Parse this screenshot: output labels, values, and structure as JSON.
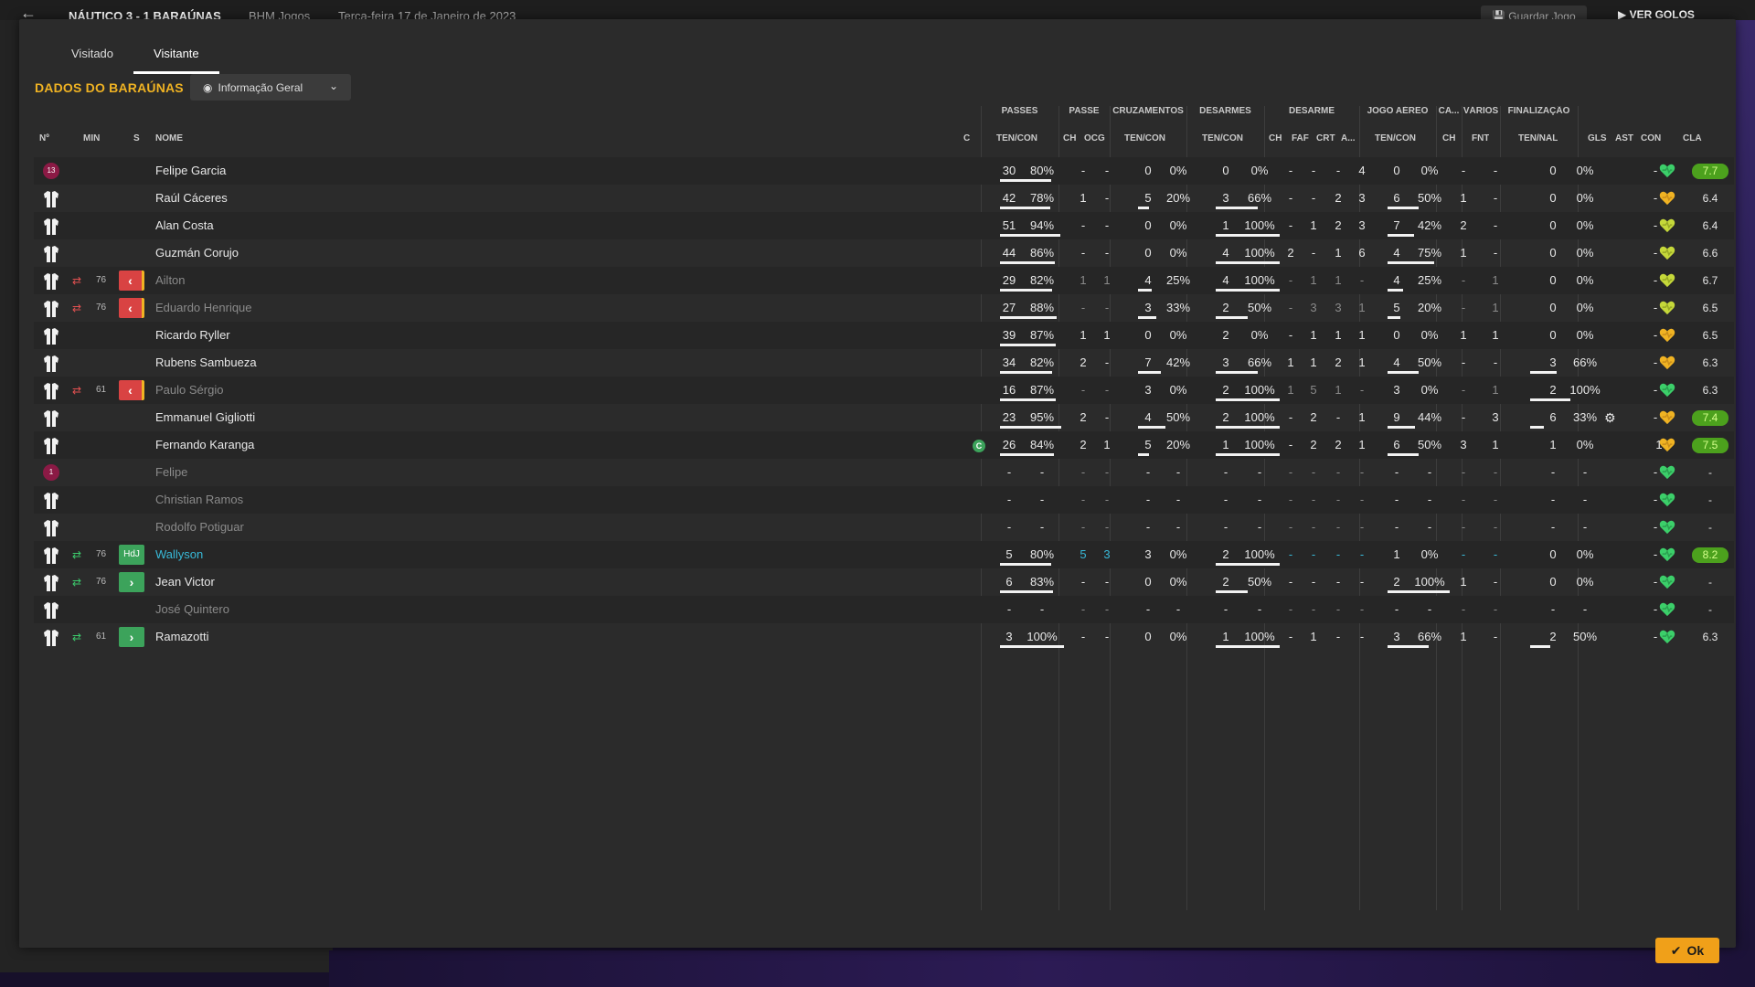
{
  "topbar": {
    "match": "NÁUTICO  3 - 1  BARAÚNAS",
    "competition": "BHM Jogos",
    "date": "Terça-feira 17 de Janeiro de 2023",
    "save_label": "Guardar Jogo",
    "goals_label": "VER GOLOS"
  },
  "tabs": [
    "Visitado",
    "Visitante"
  ],
  "active_tab": "Visitante",
  "section_title": "DADOS DO BARAÚNAS",
  "view_dropdown": "Informação Geral",
  "ok_label": "Ok",
  "group_headers": {
    "passes": "PASSES",
    "passe": "PASSE",
    "cruzamentos": "CRUZAMENTOS",
    "desarmes": "DESARMES",
    "desarme": "DESARME",
    "jogo_aereo": "JOGO AÉREO",
    "ca": "CA...",
    "varios": "VÁRIOS",
    "finalizacao": "FINALIZAÇÃO"
  },
  "col_headers": {
    "no": "Nº",
    "min": "MIN",
    "s": "S",
    "nome": "NOME",
    "c": "C",
    "pass_tc": "TEN/CON",
    "pass_ch": "CH",
    "pass_ocg": "OCG",
    "cruz_tc": "TEN/CON",
    "des_tc": "TEN/CON",
    "d_ch": "CH",
    "d_faf": "FAF",
    "d_crt": "CRT",
    "d_a": "A...",
    "ja_tc": "TEN/CON",
    "ca_ch": "CH",
    "v_fnt": "FNT",
    "fin_tn": "TEN/NAL",
    "gls": "GLS",
    "ast": "AST",
    "con": "CON",
    "cla": "CLA"
  },
  "players": [
    {
      "gk": "13",
      "min": "",
      "sub": "",
      "tag": "",
      "name": "Felipe Garcia",
      "dim": false,
      "cap": false,
      "p": [
        "30",
        "80%"
      ],
      "pch": "-",
      "pocg": "-",
      "cz": [
        "0",
        "0%"
      ],
      "ds": [
        "0",
        "0%"
      ],
      "d": [
        "-",
        "-",
        "-",
        "4"
      ],
      "ja": [
        "0",
        "0%"
      ],
      "cach": "-",
      "fnt": "-",
      "fin": [
        "0",
        "0%"
      ],
      "gear": false,
      "gls": "-",
      "ast": "",
      "con": "green",
      "cla": "7.7",
      "good": true,
      "pf": 0.8,
      "czf": 0,
      "dsf": 0,
      "jaf": 0,
      "finf": 0
    },
    {
      "gk": "",
      "min": "",
      "sub": "",
      "tag": "",
      "name": "Raúl Cáceres",
      "dim": false,
      "cap": false,
      "p": [
        "42",
        "78%"
      ],
      "pch": "1",
      "pocg": "-",
      "cz": [
        "5",
        "20%"
      ],
      "ds": [
        "3",
        "66%"
      ],
      "d": [
        "-",
        "-",
        "2",
        "3"
      ],
      "ja": [
        "6",
        "50%"
      ],
      "cach": "1",
      "fnt": "-",
      "fin": [
        "0",
        "0%"
      ],
      "gear": false,
      "gls": "-",
      "ast": "",
      "con": "amber",
      "cla": "6.4",
      "good": false,
      "pf": 0.78,
      "czf": 0.2,
      "dsf": 0.66,
      "jaf": 0.5,
      "finf": 0
    },
    {
      "gk": "",
      "min": "",
      "sub": "",
      "tag": "",
      "name": "Alan Costa",
      "dim": false,
      "cap": false,
      "p": [
        "51",
        "94%"
      ],
      "pch": "-",
      "pocg": "-",
      "cz": [
        "0",
        "0%"
      ],
      "ds": [
        "1",
        "100%"
      ],
      "d": [
        "-",
        "1",
        "2",
        "3"
      ],
      "ja": [
        "7",
        "42%"
      ],
      "cach": "2",
      "fnt": "-",
      "fin": [
        "0",
        "0%"
      ],
      "gear": false,
      "gls": "-",
      "ast": "",
      "con": "yellow",
      "cla": "6.4",
      "good": false,
      "pf": 0.94,
      "czf": 0,
      "dsf": 1,
      "jaf": 0.42,
      "finf": 0
    },
    {
      "gk": "",
      "min": "",
      "sub": "",
      "tag": "",
      "name": "Guzmán Corujo",
      "dim": false,
      "cap": false,
      "p": [
        "44",
        "86%"
      ],
      "pch": "-",
      "pocg": "-",
      "cz": [
        "0",
        "0%"
      ],
      "ds": [
        "4",
        "100%"
      ],
      "d": [
        "2",
        "-",
        "1",
        "6"
      ],
      "ja": [
        "4",
        "75%"
      ],
      "cach": "1",
      "fnt": "-",
      "fin": [
        "0",
        "0%"
      ],
      "gear": false,
      "gls": "-",
      "ast": "",
      "con": "yellow",
      "cla": "6.6",
      "good": false,
      "pf": 0.86,
      "czf": 0,
      "dsf": 1,
      "jaf": 0.75,
      "finf": 0
    },
    {
      "gk": "",
      "min": "76",
      "sub": "out",
      "tag": "out",
      "name": "Ailton",
      "dim": true,
      "cap": false,
      "p": [
        "29",
        "82%"
      ],
      "pch": "1",
      "pocg": "1",
      "cz": [
        "4",
        "25%"
      ],
      "ds": [
        "4",
        "100%"
      ],
      "d": [
        "-",
        "1",
        "1",
        "-"
      ],
      "ja": [
        "4",
        "25%"
      ],
      "cach": "-",
      "fnt": "1",
      "fin": [
        "0",
        "0%"
      ],
      "gear": false,
      "gls": "-",
      "ast": "",
      "con": "yellow",
      "cla": "6.7",
      "good": false,
      "pf": 0.82,
      "czf": 0.25,
      "dsf": 1,
      "jaf": 0.25,
      "finf": 0
    },
    {
      "gk": "",
      "min": "76",
      "sub": "out",
      "tag": "out",
      "name": "Eduardo Henrique",
      "dim": true,
      "cap": false,
      "p": [
        "27",
        "88%"
      ],
      "pch": "-",
      "pocg": "-",
      "cz": [
        "3",
        "33%"
      ],
      "ds": [
        "2",
        "50%"
      ],
      "d": [
        "-",
        "3",
        "3",
        "1"
      ],
      "ja": [
        "5",
        "20%"
      ],
      "cach": "-",
      "fnt": "1",
      "fin": [
        "0",
        "0%"
      ],
      "gear": false,
      "gls": "-",
      "ast": "",
      "con": "yellow",
      "cla": "6.5",
      "good": false,
      "pf": 0.88,
      "czf": 0.33,
      "dsf": 0.5,
      "jaf": 0.2,
      "finf": 0
    },
    {
      "gk": "",
      "min": "",
      "sub": "",
      "tag": "",
      "name": "Ricardo Ryller",
      "dim": false,
      "cap": false,
      "p": [
        "39",
        "87%"
      ],
      "pch": "1",
      "pocg": "1",
      "cz": [
        "0",
        "0%"
      ],
      "ds": [
        "2",
        "0%"
      ],
      "d": [
        "-",
        "1",
        "1",
        "1"
      ],
      "ja": [
        "0",
        "0%"
      ],
      "cach": "1",
      "fnt": "1",
      "fin": [
        "0",
        "0%"
      ],
      "gear": false,
      "gls": "-",
      "ast": "",
      "con": "amber",
      "cla": "6.5",
      "good": false,
      "pf": 0.87,
      "czf": 0,
      "dsf": 0,
      "jaf": 0,
      "finf": 0
    },
    {
      "gk": "",
      "min": "",
      "sub": "",
      "tag": "",
      "name": "Rubens Sambueza",
      "dim": false,
      "cap": false,
      "p": [
        "34",
        "82%"
      ],
      "pch": "2",
      "pocg": "-",
      "cz": [
        "7",
        "42%"
      ],
      "ds": [
        "3",
        "66%"
      ],
      "d": [
        "1",
        "1",
        "2",
        "1"
      ],
      "ja": [
        "4",
        "50%"
      ],
      "cach": "-",
      "fnt": "-",
      "fin": [
        "3",
        "66%"
      ],
      "gear": false,
      "gls": "-",
      "ast": "",
      "con": "amber",
      "cla": "6.3",
      "good": false,
      "pf": 0.82,
      "czf": 0.42,
      "dsf": 0.66,
      "jaf": 0.5,
      "finf": 0.66
    },
    {
      "gk": "",
      "min": "61",
      "sub": "out",
      "tag": "out",
      "name": "Paulo Sérgio",
      "dim": true,
      "cap": false,
      "p": [
        "16",
        "87%"
      ],
      "pch": "-",
      "pocg": "-",
      "cz": [
        "3",
        "0%"
      ],
      "ds": [
        "2",
        "100%"
      ],
      "d": [
        "1",
        "5",
        "1",
        "-"
      ],
      "ja": [
        "3",
        "0%"
      ],
      "cach": "-",
      "fnt": "1",
      "fin": [
        "2",
        "100%"
      ],
      "gear": false,
      "gls": "-",
      "ast": "",
      "con": "green",
      "cla": "6.3",
      "good": false,
      "pf": 0.87,
      "czf": 0,
      "dsf": 1,
      "jaf": 0,
      "finf": 1
    },
    {
      "gk": "",
      "min": "",
      "sub": "",
      "tag": "",
      "name": "Emmanuel Gigliotti",
      "dim": false,
      "cap": false,
      "p": [
        "23",
        "95%"
      ],
      "pch": "2",
      "pocg": "-",
      "cz": [
        "4",
        "50%"
      ],
      "ds": [
        "2",
        "100%"
      ],
      "d": [
        "-",
        "2",
        "-",
        "1"
      ],
      "ja": [
        "9",
        "44%"
      ],
      "cach": "-",
      "fnt": "3",
      "fin": [
        "6",
        "33%"
      ],
      "gear": true,
      "gls": "-",
      "ast": "",
      "con": "amber",
      "cla": "7.4",
      "good": true,
      "pf": 0.95,
      "czf": 0.5,
      "dsf": 1,
      "jaf": 0.44,
      "finf": 0.33
    },
    {
      "gk": "",
      "min": "",
      "sub": "",
      "tag": "",
      "name": "Fernando Karanga",
      "dim": false,
      "cap": true,
      "p": [
        "26",
        "84%"
      ],
      "pch": "2",
      "pocg": "1",
      "cz": [
        "5",
        "20%"
      ],
      "ds": [
        "1",
        "100%"
      ],
      "d": [
        "-",
        "2",
        "2",
        "1"
      ],
      "ja": [
        "6",
        "50%"
      ],
      "cach": "3",
      "fnt": "1",
      "fin": [
        "1",
        "0%"
      ],
      "gear": false,
      "gls": "",
      "ast": "1",
      "con": "amber",
      "cla": "7.5",
      "good": true,
      "pf": 0.84,
      "czf": 0.2,
      "dsf": 1,
      "jaf": 0.5,
      "finf": 0
    },
    {
      "gk": "1",
      "min": "",
      "sub": "",
      "tag": "",
      "name": "Felipe",
      "dim": true,
      "cap": false,
      "p": [
        "-",
        "-"
      ],
      "pch": "-",
      "pocg": "-",
      "cz": [
        "-",
        "-"
      ],
      "ds": [
        "-",
        "-"
      ],
      "d": [
        "-",
        "-",
        "-",
        "-"
      ],
      "ja": [
        "-",
        "-"
      ],
      "cach": "-",
      "fnt": "-",
      "fin": [
        "-",
        "-"
      ],
      "gear": false,
      "gls": "-",
      "ast": "",
      "con": "green",
      "cla": "-",
      "good": false,
      "pf": 0,
      "czf": 0,
      "dsf": 0,
      "jaf": 0,
      "finf": 0
    },
    {
      "gk": "",
      "min": "",
      "sub": "",
      "tag": "",
      "name": "Christian Ramos",
      "dim": true,
      "cap": false,
      "p": [
        "-",
        "-"
      ],
      "pch": "-",
      "pocg": "-",
      "cz": [
        "-",
        "-"
      ],
      "ds": [
        "-",
        "-"
      ],
      "d": [
        "-",
        "-",
        "-",
        "-"
      ],
      "ja": [
        "-",
        "-"
      ],
      "cach": "-",
      "fnt": "-",
      "fin": [
        "-",
        "-"
      ],
      "gear": false,
      "gls": "-",
      "ast": "",
      "con": "green",
      "cla": "-",
      "good": false,
      "pf": 0,
      "czf": 0,
      "dsf": 0,
      "jaf": 0,
      "finf": 0
    },
    {
      "gk": "",
      "min": "",
      "sub": "",
      "tag": "",
      "name": "Rodolfo Potiguar",
      "dim": true,
      "cap": false,
      "p": [
        "-",
        "-"
      ],
      "pch": "-",
      "pocg": "-",
      "cz": [
        "-",
        "-"
      ],
      "ds": [
        "-",
        "-"
      ],
      "d": [
        "-",
        "-",
        "-",
        "-"
      ],
      "ja": [
        "-",
        "-"
      ],
      "cach": "-",
      "fnt": "-",
      "fin": [
        "-",
        "-"
      ],
      "gear": false,
      "gls": "-",
      "ast": "",
      "con": "green",
      "cla": "-",
      "good": false,
      "pf": 0,
      "czf": 0,
      "dsf": 0,
      "jaf": 0,
      "finf": 0
    },
    {
      "gk": "",
      "min": "76",
      "sub": "in",
      "tag": "hdj",
      "name": "Wallyson",
      "dim": false,
      "hl": true,
      "cap": false,
      "p": [
        "5",
        "80%"
      ],
      "pch": "5",
      "pocg": "3",
      "cz": [
        "3",
        "0%"
      ],
      "ds": [
        "2",
        "100%"
      ],
      "d": [
        "-",
        "-",
        "-",
        "-"
      ],
      "ja": [
        "1",
        "0%"
      ],
      "cach": "-",
      "fnt": "-",
      "fin": [
        "0",
        "0%"
      ],
      "gear": false,
      "gls": "-",
      "ast": "",
      "con": "green",
      "cla": "8.2",
      "good": true,
      "pf": 0.8,
      "czf": 0,
      "dsf": 1,
      "jaf": 0,
      "finf": 0
    },
    {
      "gk": "",
      "min": "76",
      "sub": "in",
      "tag": "in",
      "name": "Jean Victor",
      "dim": false,
      "cap": false,
      "p": [
        "6",
        "83%"
      ],
      "pch": "-",
      "pocg": "-",
      "cz": [
        "0",
        "0%"
      ],
      "ds": [
        "2",
        "50%"
      ],
      "d": [
        "-",
        "-",
        "-",
        "-"
      ],
      "ja": [
        "2",
        "100%"
      ],
      "cach": "1",
      "fnt": "-",
      "fin": [
        "0",
        "0%"
      ],
      "gear": false,
      "gls": "-",
      "ast": "",
      "con": "green",
      "cla": "-",
      "good": false,
      "pf": 0.83,
      "czf": 0,
      "dsf": 0.5,
      "jaf": 1,
      "finf": 0
    },
    {
      "gk": "",
      "min": "",
      "sub": "",
      "tag": "",
      "name": "José Quintero",
      "dim": true,
      "cap": false,
      "p": [
        "-",
        "-"
      ],
      "pch": "-",
      "pocg": "-",
      "cz": [
        "-",
        "-"
      ],
      "ds": [
        "-",
        "-"
      ],
      "d": [
        "-",
        "-",
        "-",
        "-"
      ],
      "ja": [
        "-",
        "-"
      ],
      "cach": "-",
      "fnt": "-",
      "fin": [
        "-",
        "-"
      ],
      "gear": false,
      "gls": "-",
      "ast": "",
      "con": "green",
      "cla": "-",
      "good": false,
      "pf": 0,
      "czf": 0,
      "dsf": 0,
      "jaf": 0,
      "finf": 0
    },
    {
      "gk": "",
      "min": "61",
      "sub": "in",
      "tag": "in",
      "name": "Ramazotti",
      "dim": false,
      "cap": false,
      "p": [
        "3",
        "100%"
      ],
      "pch": "-",
      "pocg": "-",
      "cz": [
        "0",
        "0%"
      ],
      "ds": [
        "1",
        "100%"
      ],
      "d": [
        "-",
        "1",
        "-",
        "-"
      ],
      "ja": [
        "3",
        "66%"
      ],
      "cach": "1",
      "fnt": "-",
      "fin": [
        "2",
        "50%"
      ],
      "gear": false,
      "gls": "-",
      "ast": "",
      "con": "green",
      "cla": "6.3",
      "good": false,
      "pf": 1,
      "czf": 0,
      "dsf": 1,
      "jaf": 0.66,
      "finf": 0.5
    }
  ],
  "colors": {
    "accent": "#f0b323",
    "good_rating": "#4ca11d",
    "ok": "#f0a019"
  }
}
